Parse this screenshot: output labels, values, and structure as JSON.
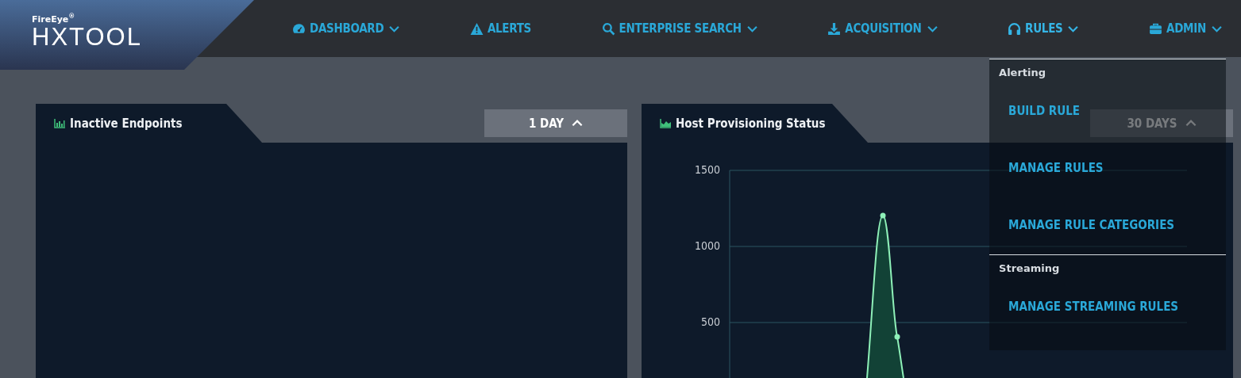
{
  "logo": {
    "brand": "FireEye",
    "registered": "®",
    "product": "HXTOOL"
  },
  "nav": [
    {
      "label": "DASHBOARD",
      "kind": "dropdown",
      "expanded": false
    },
    {
      "label": "ALERTS",
      "kind": "link",
      "expanded": false
    },
    {
      "label": "ENTERPRISE SEARCH",
      "kind": "dropdown",
      "expanded": false
    },
    {
      "label": "ACQUISITION",
      "kind": "dropdown",
      "expanded": false
    },
    {
      "label": "RULES",
      "kind": "dropdown",
      "expanded": true
    },
    {
      "label": "ADMIN",
      "kind": "dropdown",
      "expanded": false
    }
  ],
  "rules_menu": [
    {
      "heading": "Alerting",
      "items": [
        "BUILD RULE",
        "MANAGE RULES",
        "MANAGE RULE CATEGORIES"
      ]
    },
    {
      "heading": "Streaming",
      "items": [
        "MANAGE STREAMING RULES"
      ]
    }
  ],
  "panels": [
    {
      "title": "Inactive Endpoints",
      "kind": "bar",
      "range": "1 DAY"
    },
    {
      "title": "Host Provisioning Status",
      "kind": "area",
      "range": "30 DAYS",
      "y_axis_labels": [
        "1500",
        "1000",
        "500"
      ]
    }
  ]
}
